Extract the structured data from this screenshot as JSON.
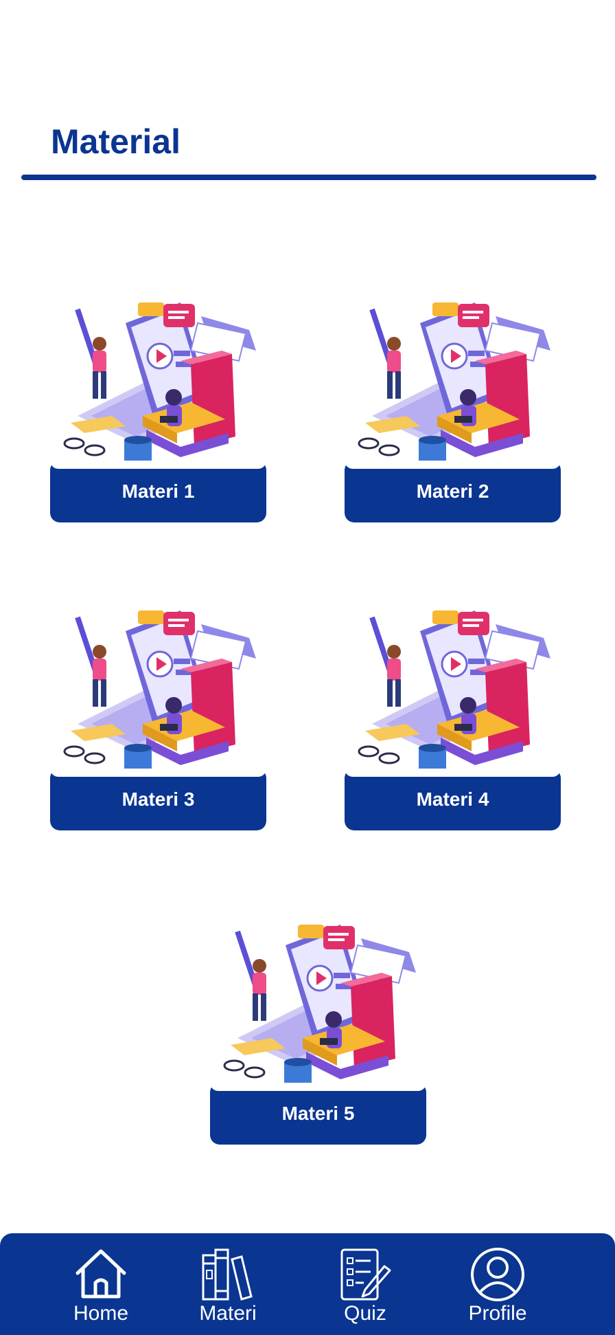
{
  "header": {
    "title": "Material"
  },
  "cards": [
    {
      "label": "Materi 1"
    },
    {
      "label": "Materi 2"
    },
    {
      "label": "Materi 3"
    },
    {
      "label": "Materi 4"
    },
    {
      "label": "Materi 5"
    }
  ],
  "nav": {
    "items": [
      {
        "label": "Home",
        "icon": "home-icon"
      },
      {
        "label": "Materi",
        "icon": "books-icon"
      },
      {
        "label": "Quiz",
        "icon": "quiz-icon"
      },
      {
        "label": "Profile",
        "icon": "profile-icon"
      }
    ]
  },
  "colors": {
    "primary": "#0a3591",
    "background": "#ffffff"
  }
}
